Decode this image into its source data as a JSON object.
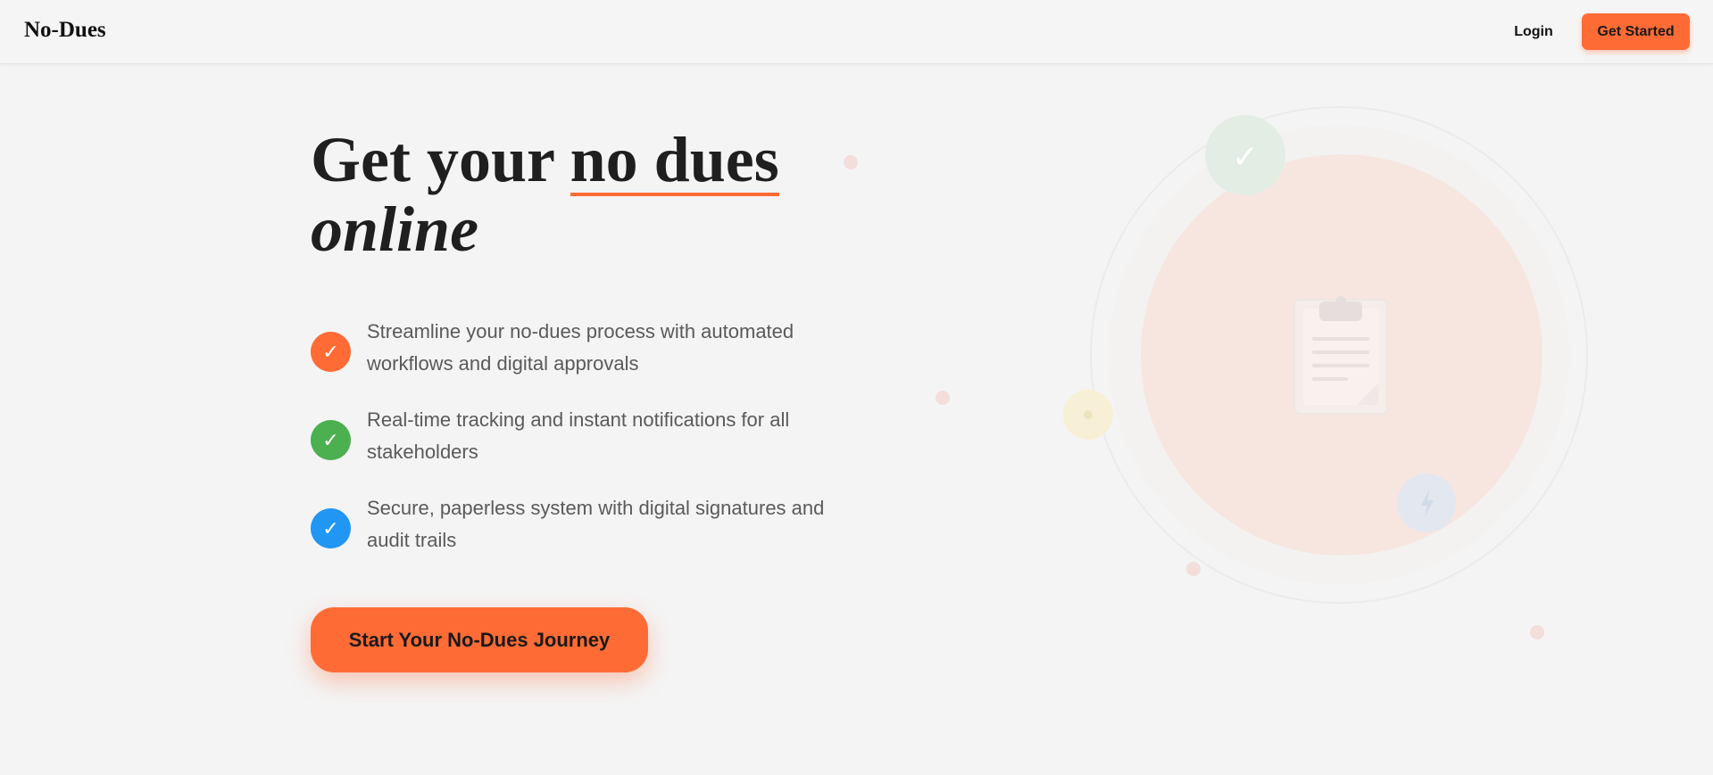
{
  "header": {
    "brand": "No-Dues",
    "login_label": "Login",
    "get_started_label": "Get Started"
  },
  "hero": {
    "title_plain": "Get your ",
    "title_highlight": "no dues",
    "title_italic": "online",
    "features": [
      {
        "text": "Streamline your no-dues process with automated workflows and digital approvals",
        "icon": "check-icon",
        "color": "#ff6b35"
      },
      {
        "text": "Real-time tracking and instant notifications for all stakeholders",
        "icon": "check-icon",
        "color": "#4caf50"
      },
      {
        "text": "Secure, paperless system with digital signatures and audit trails",
        "icon": "check-icon",
        "color": "#2196f3"
      }
    ],
    "cta_label": "Start Your No-Dues Journey"
  },
  "illustration": {
    "center_icon": "clipboard-icon",
    "orbit_icons": [
      "check-icon",
      "sun-icon",
      "lightning-icon"
    ]
  },
  "colors": {
    "accent": "#ff6b35",
    "success": "#4caf50",
    "info": "#2196f3",
    "background": "#f4f4f4"
  }
}
